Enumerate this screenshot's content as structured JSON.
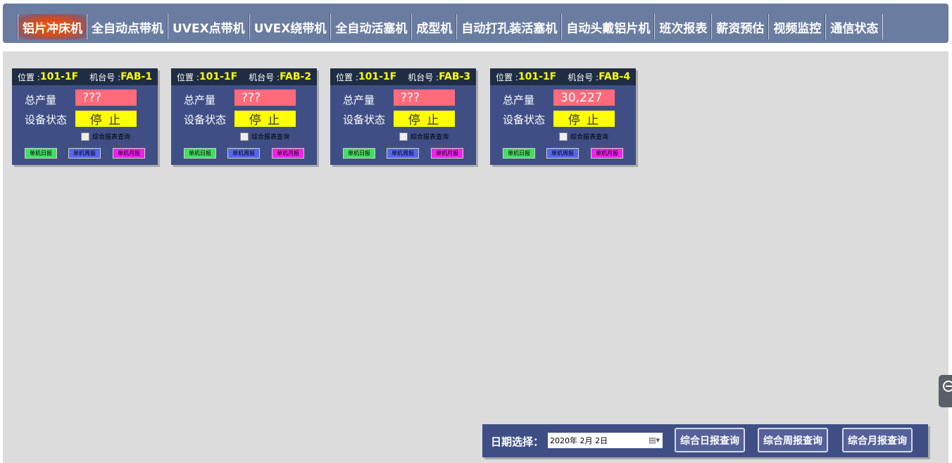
{
  "nav": {
    "items": [
      {
        "label": "铝片冲床机"
      },
      {
        "label": "全自动点带机"
      },
      {
        "label": "UVEX点带机"
      },
      {
        "label": "UVEX绕带机"
      },
      {
        "label": "全自动活塞机"
      },
      {
        "label": "成型机"
      },
      {
        "label": "自动打孔装活塞机"
      },
      {
        "label": "自动头戴铝片机"
      },
      {
        "label": "班次报表"
      },
      {
        "label": "薪资预估"
      },
      {
        "label": "视频监控"
      },
      {
        "label": "通信状态"
      }
    ],
    "active_index": 0
  },
  "cards": [
    {
      "position_label": "位置 :",
      "position": "101-1F",
      "machine_label": "机台号 :",
      "machine": "FAB-1",
      "output_label": "总产量",
      "output": "???",
      "status_label": "设备状态",
      "status": "停 止",
      "checkbox_label": "综合报表查询",
      "daily": "单机日报",
      "weekly": "单机周报",
      "monthly": "单机月报"
    },
    {
      "position_label": "位置 :",
      "position": "101-1F",
      "machine_label": "机台号 :",
      "machine": "FAB-2",
      "output_label": "总产量",
      "output": "???",
      "status_label": "设备状态",
      "status": "停 止",
      "checkbox_label": "综合报表查询",
      "daily": "单机日报",
      "weekly": "单机周报",
      "monthly": "单机月报"
    },
    {
      "position_label": "位置 :",
      "position": "101-1F",
      "machine_label": "机台号 :",
      "machine": "FAB-3",
      "output_label": "总产量",
      "output": "???",
      "status_label": "设备状态",
      "status": "停 止",
      "checkbox_label": "综合报表查询",
      "daily": "单机日报",
      "weekly": "单机周报",
      "monthly": "单机月报"
    },
    {
      "position_label": "位置 :",
      "position": "101-1F",
      "machine_label": "机台号 :",
      "machine": "FAB-4",
      "output_label": "总产量",
      "output": "30,227",
      "status_label": "设备状态",
      "status": "停 止",
      "checkbox_label": "综合报表查询",
      "daily": "单机日报",
      "weekly": "单机周报",
      "monthly": "单机月报"
    }
  ],
  "datebar": {
    "label": "日期选择：",
    "date_value": "2020年  2月  2日",
    "daily_query": "综合日报查询",
    "weekly_query": "综合周报查询",
    "monthly_query": "综合月报查询"
  },
  "colors": {
    "nav_bg": "#6b7ca1",
    "card_bg": "#3f4f86",
    "card_header": "#1f2d44",
    "output_box": "#ff6b7a",
    "status_box": "#ffff00",
    "daily_btn": "#44dd66",
    "weekly_btn": "#5566ee",
    "monthly_btn": "#ee22ee"
  },
  "icons": {
    "calendar": "calendar-icon",
    "side_tab": "collapse-icon"
  }
}
